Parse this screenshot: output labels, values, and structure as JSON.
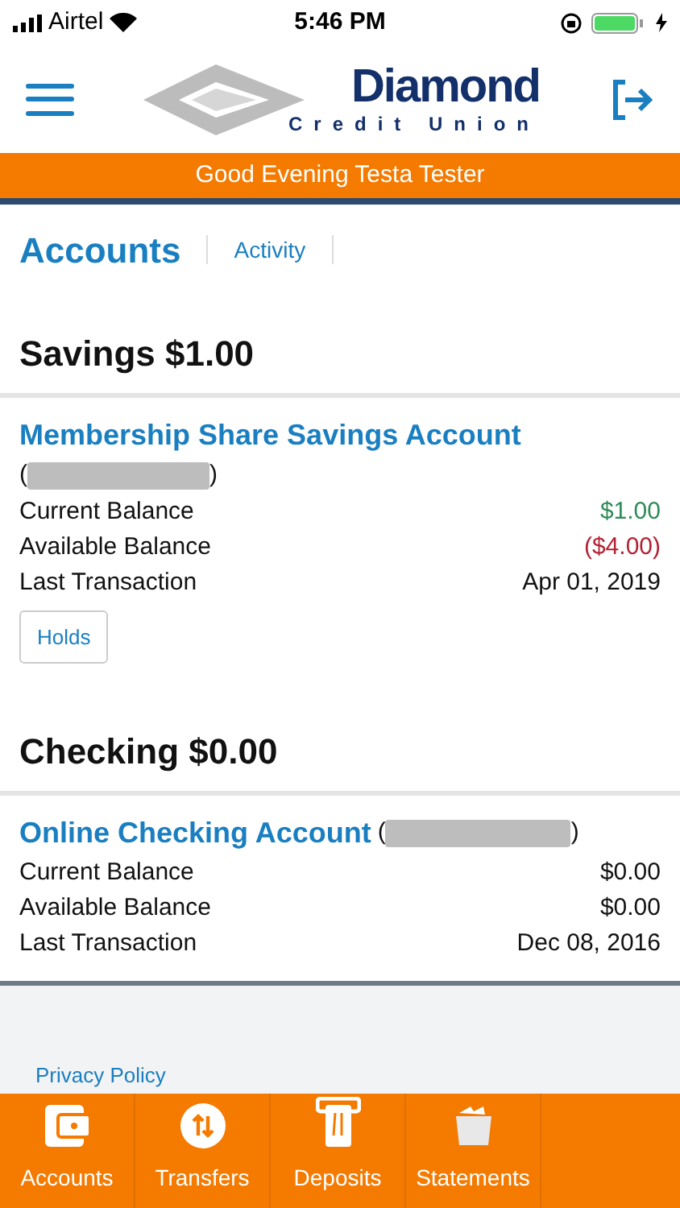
{
  "status_bar": {
    "carrier": "Airtel",
    "time": "5:46 PM"
  },
  "header": {
    "logo_name": "Diamond",
    "logo_tagline": "Credit Union"
  },
  "greeting": "Good Evening Testa Tester",
  "tabs": [
    {
      "label": "Accounts",
      "selected": true
    },
    {
      "label": "Activity",
      "selected": false
    }
  ],
  "groups": [
    {
      "title": "Savings $1.00",
      "accounts": [
        {
          "name": "Membership Share Savings Account",
          "kind": "stacked",
          "brackets": [
            "(",
            ")"
          ],
          "rows": [
            {
              "label": "Current Balance",
              "value": "$1.00",
              "kind": "positive"
            },
            {
              "label": "Available Balance",
              "value": "($4.00)",
              "kind": "negative"
            },
            {
              "label": "Last Transaction",
              "value": "Apr 01, 2019",
              "kind": "neutral"
            }
          ],
          "button": "Holds"
        }
      ]
    },
    {
      "title": "Checking $0.00",
      "accounts": [
        {
          "name": "Online Checking Account",
          "kind": "inline",
          "brackets": [
            "(",
            ")"
          ],
          "rows": [
            {
              "label": "Current Balance",
              "value": "$0.00",
              "kind": "neutral"
            },
            {
              "label": "Available Balance",
              "value": "$0.00",
              "kind": "neutral"
            },
            {
              "label": "Last Transaction",
              "value": "Dec 08, 2016",
              "kind": "neutral"
            }
          ]
        }
      ]
    }
  ],
  "footer_link": "Privacy Policy",
  "bottom_nav": [
    {
      "label": "Accounts",
      "kind": "wallet"
    },
    {
      "label": "Transfers",
      "kind": "transfer"
    },
    {
      "label": "Deposits",
      "kind": "deposit"
    },
    {
      "label": "Statements",
      "kind": "folder"
    }
  ]
}
